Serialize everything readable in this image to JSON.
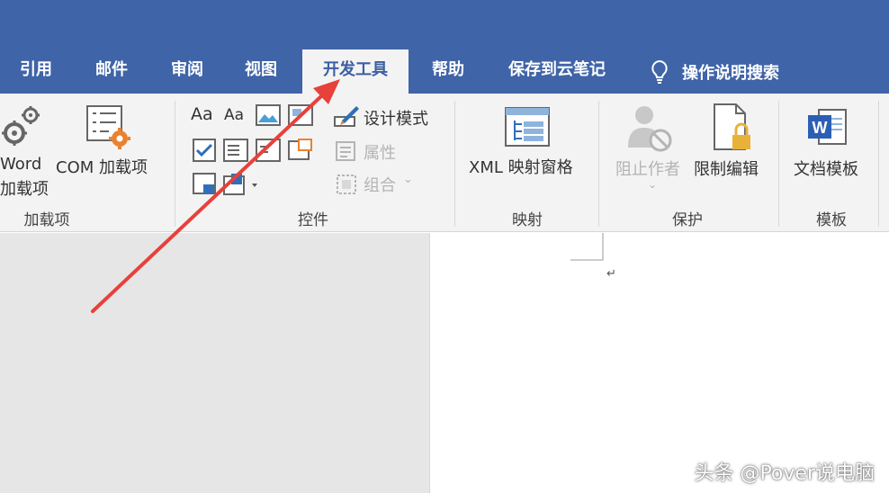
{
  "tabs": [
    {
      "label": "引用"
    },
    {
      "label": "邮件"
    },
    {
      "label": "审阅"
    },
    {
      "label": "视图"
    },
    {
      "label": "开发工具"
    },
    {
      "label": "帮助"
    },
    {
      "label": "保存到云笔记"
    }
  ],
  "active_tab": "开发工具",
  "tell_me": {
    "label": "操作说明搜索",
    "icon": "lightbulb-icon"
  },
  "groups": {
    "addins": {
      "label": "加载项",
      "word_addins_line1": "Word",
      "word_addins_line2": "加载项",
      "com_addins": "COM 加载项"
    },
    "controls": {
      "label": "控件",
      "design_mode": "设计模式",
      "properties": "属性",
      "group": "组合",
      "aa_rich": "Aa",
      "aa_plain": "Aa"
    },
    "mapping": {
      "label": "映射",
      "xml_pane": "XML 映射窗格"
    },
    "protect": {
      "label": "保护",
      "block_authors": "阻止作者",
      "restrict_editing": "限制编辑"
    },
    "templates": {
      "label": "模板",
      "document_template": "文档模板"
    }
  },
  "document": {
    "paragraph_mark": "↵"
  },
  "watermark": "头条 @Pover说电脑",
  "colors": {
    "title_bar": "#3f64a8",
    "ribbon_bg": "#f3f3f3",
    "arrow": "#e8403a"
  }
}
